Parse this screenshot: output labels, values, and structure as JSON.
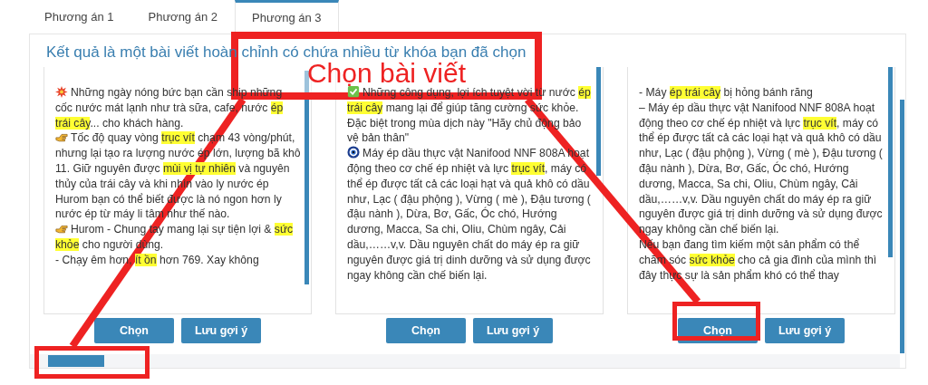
{
  "tabs": [
    {
      "label": "Phương án 1",
      "selected": false
    },
    {
      "label": "Phương án 2",
      "selected": false
    },
    {
      "label": "Phương án 3",
      "selected": true
    }
  ],
  "heading": "Kết quả là một bài viết hoàn chỉnh có chứa nhiều từ khóa bạn đã chọn",
  "articles": [
    {
      "paragraphs": [
        {
          "kind": "burst",
          "segments": [
            {
              "text": "Những ngày nóng bức bạn cần ship những cốc nước mát lạnh như trà sữa, cafe, nước ",
              "highlight": false
            },
            {
              "text": "ép trái cây",
              "highlight": true
            },
            {
              "text": "... cho khách hàng.",
              "highlight": false
            }
          ]
        },
        {
          "kind": "hand",
          "segments": [
            {
              "text": "Tốc độ quay vòng ",
              "highlight": false
            },
            {
              "text": "trục vít",
              "highlight": true
            },
            {
              "text": " chạm 43 vòng/phút, nhưng lại tạo ra lượng nước ép lớn, lượng bã khô",
              "highlight": false
            }
          ]
        },
        {
          "kind": "plain",
          "segments": [
            {
              "text": "11. Giữ nguyên được ",
              "highlight": false
            },
            {
              "text": "mùi vị tự nhiên",
              "highlight": true
            },
            {
              "text": " và nguyên thủy của trái cây và khi nhìn vào ly nước ép Hurom bạn có thể biết được là nó ngon hơn ly nước ép từ máy li tâm như thế nào.",
              "highlight": false
            }
          ]
        },
        {
          "kind": "hand",
          "segments": [
            {
              "text": "Hurom - Chung tay mang lại sự tiện lợi & ",
              "highlight": false
            },
            {
              "text": "sức khỏe",
              "highlight": true
            },
            {
              "text": " cho người dùng.",
              "highlight": false
            }
          ]
        },
        {
          "kind": "plain",
          "segments": [
            {
              "text": "- Chạy êm hơn, ",
              "highlight": false
            },
            {
              "text": "ít ồn",
              "highlight": true
            },
            {
              "text": " hơn 769. Xay không",
              "highlight": false
            }
          ]
        }
      ],
      "buttons": [
        "Chọn",
        "Lưu gợi ý"
      ]
    },
    {
      "paragraphs": [
        {
          "kind": "check",
          "segments": [
            {
              "text": "Những công dụng, lợi ích tuyệt vời từ nước ",
              "highlight": false
            },
            {
              "text": "ép trái cây",
              "highlight": true
            },
            {
              "text": " mang lại để giúp tăng cường sức khỏe. Đặc biệt trong mùa dịch này \"Hãy chủ động bảo vệ bản thân\"",
              "highlight": false
            }
          ]
        },
        {
          "kind": "eye",
          "segments": [
            {
              "text": "Máy ép dầu thực vật Nanifood NNF 808A hoạt động theo cơ chế ép nhiệt và lực ",
              "highlight": false
            },
            {
              "text": "trục vít",
              "highlight": true
            },
            {
              "text": ", máy có thể ép được tất cả các loại hạt và quả khô có dầu như, Lạc ( đậu phộng ), Vừng ( mè ), Đậu tương ( đậu nành ), Dừa, Bơ, Gấc, Óc chó, Hướng dương, Macca, Sa chi, Oliu, Chùm ngây, Cải dầu,……v,v. Dầu nguyên chất do máy ép ra giữ nguyên được giá trị dinh dưỡng và sử dụng được ngay không cần chế biến lại.",
              "highlight": false
            }
          ]
        }
      ],
      "buttons": [
        "Chọn",
        "Lưu gợi ý"
      ]
    },
    {
      "paragraphs": [
        {
          "kind": "plain",
          "segments": [
            {
              "text": "- Máy ",
              "highlight": false
            },
            {
              "text": "ép trái cây",
              "highlight": true
            },
            {
              "text": " bị hỏng bánh răng",
              "highlight": false
            }
          ]
        },
        {
          "kind": "plain",
          "segments": [
            {
              "text": "– Máy ép dầu thực vật Nanifood NNF 808A hoạt động theo cơ chế ép nhiệt và lực ",
              "highlight": false
            },
            {
              "text": "trục vít",
              "highlight": true
            },
            {
              "text": ", máy có thể ép được tất cả các loại hạt và quả khô có dầu như, Lạc ( đậu phộng ), Vừng ( mè ), Đậu tương ( đậu nành ), Dừa, Bơ, Gấc, Óc chó, Hướng dương, Macca, Sa chi, Oliu, Chùm ngây, Cải dầu,……v,v. Dầu nguyên chất do máy ép ra giữ nguyên được giá trị dinh dưỡng và sử dụng được ngay không cần chế biến lại.",
              "highlight": false
            }
          ]
        },
        {
          "kind": "plain",
          "segments": [
            {
              "text": "Nếu bạn đang tìm kiếm một sản phẩm có thể chăm sóc ",
              "highlight": false
            },
            {
              "text": "sức khỏe",
              "highlight": true
            },
            {
              "text": " cho cả gia đình của mình thì đây thực sự là sản phẩm khó có thể thay",
              "highlight": false
            }
          ]
        }
      ],
      "buttons": [
        "Chọn",
        "Lưu gợi ý"
      ]
    }
  ],
  "annotation": {
    "label": "Chọn bài viết"
  }
}
